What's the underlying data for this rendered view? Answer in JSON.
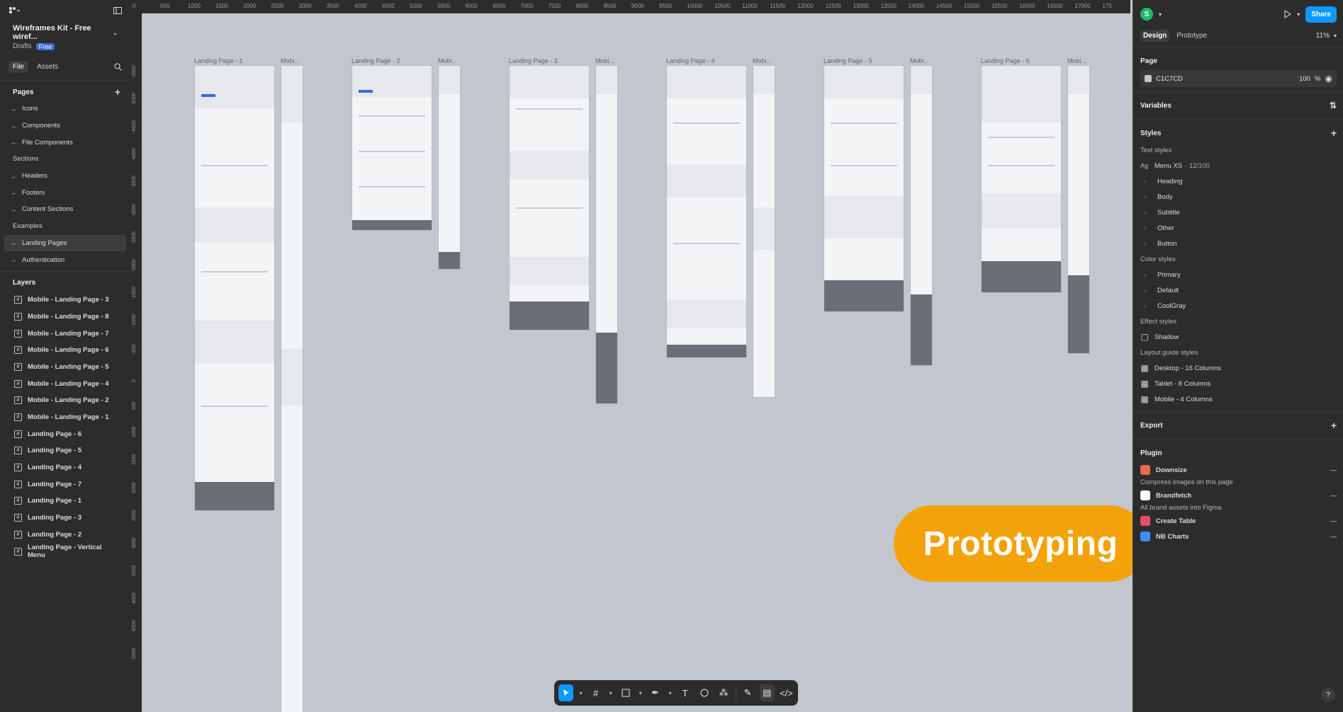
{
  "left_panel": {
    "file_title": "Wireframes Kit - Free wiref...",
    "drafts": "Drafts",
    "plan_badge": "Free",
    "tabs": [
      "File",
      "Assets"
    ],
    "pages_header": "Pages",
    "pages": [
      {
        "label": "Icons",
        "kind": "page"
      },
      {
        "label": "Components",
        "kind": "page"
      },
      {
        "label": "File Components",
        "kind": "page"
      },
      {
        "label": "Sections",
        "kind": "section"
      },
      {
        "label": "Headers",
        "kind": "page"
      },
      {
        "label": "Footers",
        "kind": "page"
      },
      {
        "label": "Content Sections",
        "kind": "page"
      },
      {
        "label": "Examples",
        "kind": "section"
      },
      {
        "label": "Landing Pages",
        "kind": "page",
        "selected": true
      },
      {
        "label": "Authentication",
        "kind": "page"
      }
    ],
    "layers_header": "Layers",
    "layers": [
      "Mobile - Landing Page - 3",
      "Mobile - Landing Page - 8",
      "Mobile - Landing Page - 7",
      "Mobile - Landing Page - 6",
      "Mobile - Landing Page - 5",
      "Mobile - Landing Page - 4",
      "Mobile - Landing Page - 2",
      "Mobile - Landing Page - 1",
      "Landing Page - 6",
      "Landing Page - 5",
      "Landing Page - 4",
      "Landing Page - 7",
      "Landing Page - 1",
      "Landing Page - 3",
      "Landing Page - 2",
      "Landing Page - Vertical Menu"
    ]
  },
  "ruler": {
    "top_ticks": [
      "0",
      "500",
      "1000",
      "1500",
      "2000",
      "2500",
      "3000",
      "3500",
      "4000",
      "4500",
      "5000",
      "5500",
      "6000",
      "6500",
      "7000",
      "7500",
      "8000",
      "8500",
      "9000",
      "9500",
      "10000",
      "10500",
      "11000",
      "11500",
      "12000",
      "12500",
      "13000",
      "13500",
      "14000",
      "14500",
      "15000",
      "15500",
      "16000",
      "16500",
      "17000",
      "175"
    ],
    "left_ticks": [
      "-5500",
      "-5000",
      "-4500",
      "-4000",
      "-3500",
      "-3000",
      "-2500",
      "-2000",
      "-1500",
      "-1000",
      "-500",
      "0",
      "500",
      "1000",
      "1500",
      "2000",
      "2500",
      "3000",
      "3500",
      "4000",
      "4500",
      "5000"
    ]
  },
  "canvas": {
    "background": "#C1C7CD",
    "frame_labels": {
      "lp1": "Landing Page - 1",
      "m1": "Mobi...",
      "lp2": "Landing Page - 2",
      "m2": "Mobi...",
      "lp3": "Landing Page - 3",
      "m3": "Mobi...",
      "lp4": "Landing Page - 4",
      "m4": "Mobi...",
      "lp5": "Landing Page - 5",
      "m5": "Mobi...",
      "lp6": "Landing Page - 6",
      "m6": "Mobi..."
    },
    "badge": "Prototyping",
    "badge_color": "#F4A20A"
  },
  "toolbar": {
    "tools": [
      "move-icon",
      "frame-icon",
      "rectangle-icon",
      "pen-icon",
      "text-icon",
      "comment-icon",
      "actions-icon",
      "draw-icon",
      "design-mode-icon",
      "dev-mode-icon"
    ]
  },
  "right_panel": {
    "avatar_initial": "S",
    "share_label": "Share",
    "tabs": [
      "Design",
      "Prototype"
    ],
    "zoom": "11%",
    "page_header": "Page",
    "page_color": "C1C7CD",
    "page_opacity": "100",
    "page_opacity_unit": "%",
    "variables_header": "Variables",
    "styles_header": "Styles",
    "text_styles_header": "Text styles",
    "text_style_first": {
      "prefix": "Ag",
      "name": "Menu XS",
      "meta": "· 12/100"
    },
    "text_style_groups": [
      "Heading",
      "Body",
      "Subtitle",
      "Other",
      "Button"
    ],
    "color_styles_header": "Color styles",
    "color_style_groups": [
      "Primary",
      "Default",
      "CoolGray"
    ],
    "effect_styles_header": "Effect styles",
    "effect_styles": [
      "Shadow"
    ],
    "layout_guide_header": "Layout guide styles",
    "layout_guides": [
      "Desktop - 16 Columns",
      "Tablet - 8 Columns",
      "Mobile - 4 Columns"
    ],
    "export_header": "Export",
    "plugin_header": "Plugin",
    "plugins": [
      {
        "name": "Downsize",
        "desc": "Compress images on this page",
        "color": "#E86A4A"
      },
      {
        "name": "Brandfetch",
        "desc": "All brand assets into Figma",
        "color": "#FFFFFF"
      },
      {
        "name": "Create Table",
        "desc": "",
        "color": "#E84A6A"
      },
      {
        "name": "NB Charts",
        "desc": "",
        "color": "#3A8DFF"
      }
    ],
    "help_label": "?"
  }
}
